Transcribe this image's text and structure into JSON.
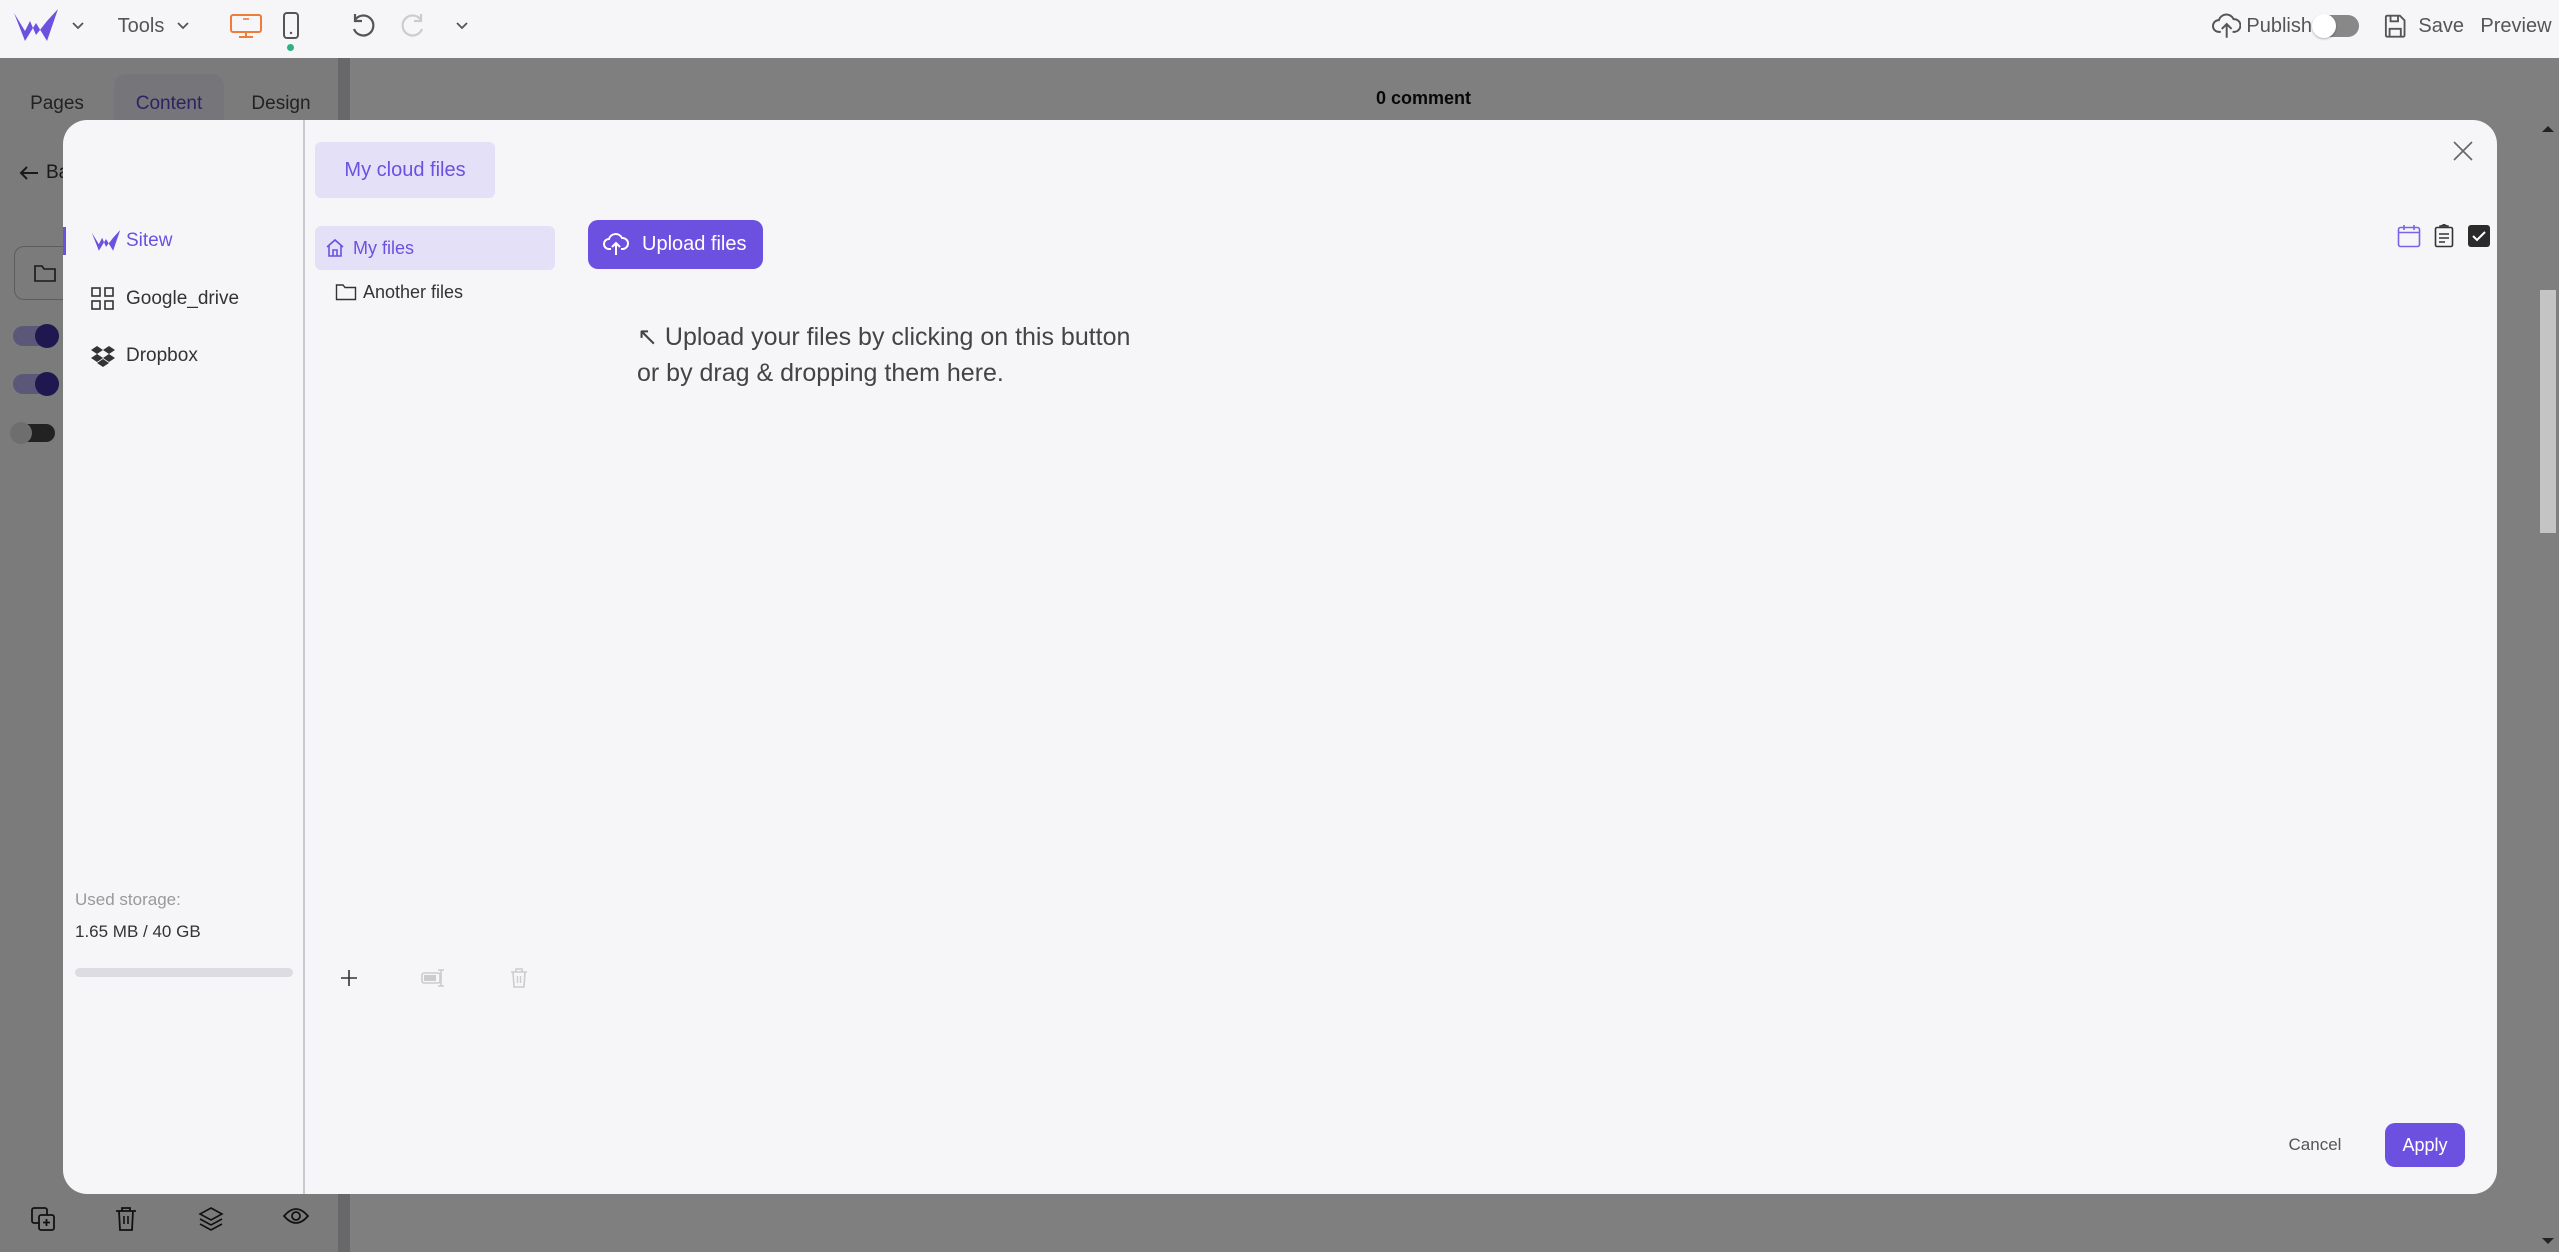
{
  "topbar": {
    "tools_label": "Tools",
    "publish_label": "Publish",
    "publish_toggle_on": false,
    "save_label": "Save",
    "preview_label": "Preview"
  },
  "left_panel": {
    "tabs": [
      {
        "label": "Pages",
        "active": false
      },
      {
        "label": "Content",
        "active": true
      },
      {
        "label": "Design",
        "active": false
      }
    ],
    "back_label": "Ba"
  },
  "canvas": {
    "comment_count": "0 comment"
  },
  "modal": {
    "providers": [
      {
        "label": "Sitew",
        "icon": "sitew-logo-icon",
        "active": true
      },
      {
        "label": "Google_drive",
        "icon": "grid-icon",
        "active": false
      },
      {
        "label": "Dropbox",
        "icon": "dropbox-icon",
        "active": false
      }
    ],
    "storage": {
      "label": "Used storage:",
      "value": "1.65 MB / 40 GB",
      "used_fraction": 4e-05
    },
    "cloud_tab_label": "My cloud files",
    "folders": [
      {
        "label": "My files",
        "icon": "home-icon",
        "active": true
      },
      {
        "label": "Another files",
        "icon": "folder-icon",
        "active": false
      }
    ],
    "upload_button_label": "Upload files",
    "hint_line1": "Upload your files by clicking on this button",
    "hint_line2": "or by drag & dropping them here.",
    "hint_arrow": "↖",
    "cancel_label": "Cancel",
    "apply_label": "Apply"
  },
  "colors": {
    "accent": "#6c51e0",
    "accent_light": "#e4e0f8",
    "desktop_icon": "#f07c3a",
    "status_dot": "#2db37e"
  }
}
